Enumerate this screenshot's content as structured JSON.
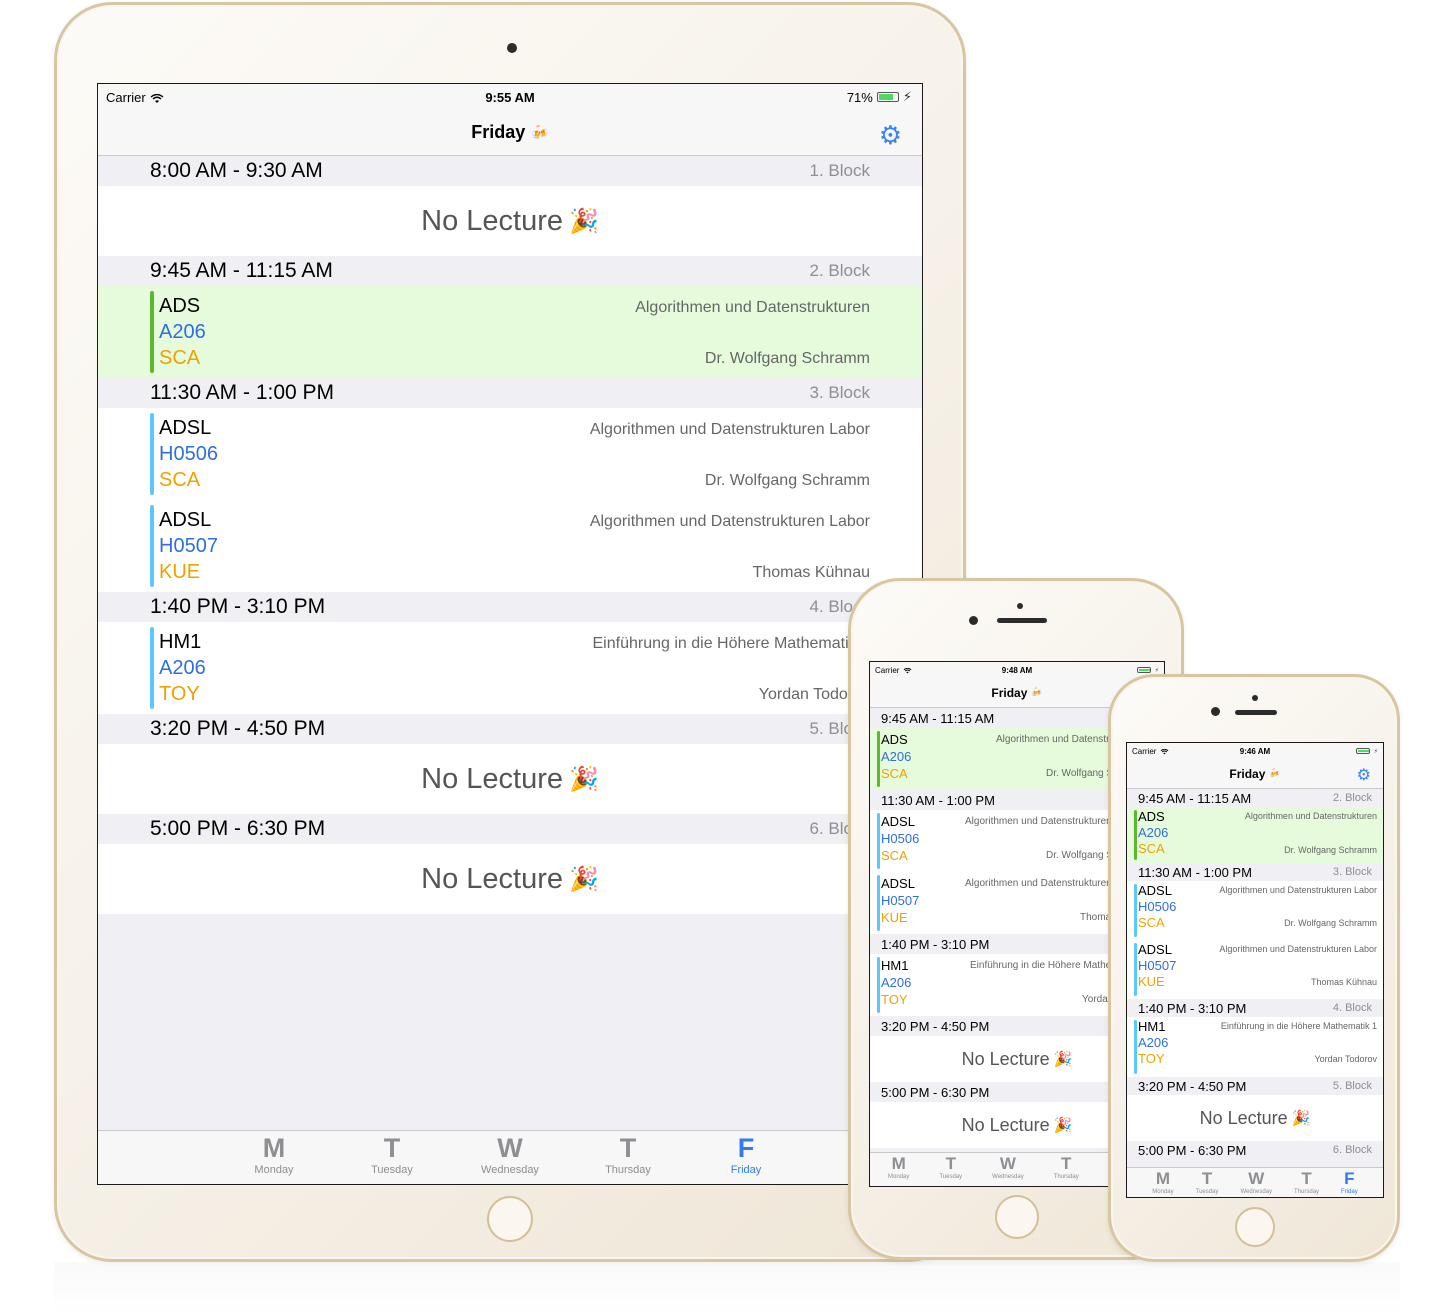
{
  "status": {
    "carrier": "Carrier",
    "ipad_time": "9:55 AM",
    "ipad_battery": "71%",
    "phone1_time": "9:48 AM",
    "phone2_time": "9:46 AM",
    "battery_level_pct": 71
  },
  "nav": {
    "title": "Friday",
    "title_emoji": "🍻",
    "settings_icon": "gear-icon"
  },
  "no_lecture": {
    "text": "No Lecture",
    "emoji": "🎉"
  },
  "blocks": [
    {
      "time": "8:00 AM - 9:30 AM",
      "label": "1. Block"
    },
    {
      "time": "9:45 AM - 11:15 AM",
      "label": "2. Block"
    },
    {
      "time": "11:30 AM - 1:00 PM",
      "label": "3. Block"
    },
    {
      "time": "1:40 PM - 3:10 PM",
      "label": "4. Block"
    },
    {
      "time": "3:20 PM - 4:50 PM",
      "label": "5. Block"
    },
    {
      "time": "5:00 PM - 6:30 PM",
      "label": "6. Block"
    }
  ],
  "lectures": [
    {
      "code": "ADS",
      "room": "A206",
      "lecturer_code": "SCA",
      "name": "Algorithmen und Datenstrukturen",
      "prof": "Dr. Wolfgang Schramm",
      "bar_color": "#5cb82e",
      "current": true
    },
    {
      "code": "ADSL",
      "room": "H0506",
      "lecturer_code": "SCA",
      "name": "Algorithmen und Datenstrukturen Labor",
      "prof": "Dr. Wolfgang Schramm",
      "bar_color": "#5ac8fa",
      "current": false
    },
    {
      "code": "ADSL",
      "room": "H0507",
      "lecturer_code": "KUE",
      "name": "Algorithmen und Datenstrukturen Labor",
      "prof": "Thomas Kühnau",
      "bar_color": "#5ac8fa",
      "current": false
    },
    {
      "code": "HM1",
      "room": "A206",
      "lecturer_code": "TOY",
      "name": "Einführung in die Höhere Mathematik 1",
      "prof": "Yordan Todorov",
      "bar_color": "#5ac8fa",
      "current": false
    }
  ],
  "tabs": [
    {
      "letter": "M",
      "label": "Monday"
    },
    {
      "letter": "T",
      "label": "Tuesday"
    },
    {
      "letter": "W",
      "label": "Wednesday"
    },
    {
      "letter": "T",
      "label": "Thursday"
    },
    {
      "letter": "F",
      "label": "Friday"
    }
  ],
  "colors": {
    "accent": "#2f7bf5",
    "current_bg": "#e5fbdb",
    "room": "#2e6ee0",
    "lecturer_code": "#eca300"
  }
}
